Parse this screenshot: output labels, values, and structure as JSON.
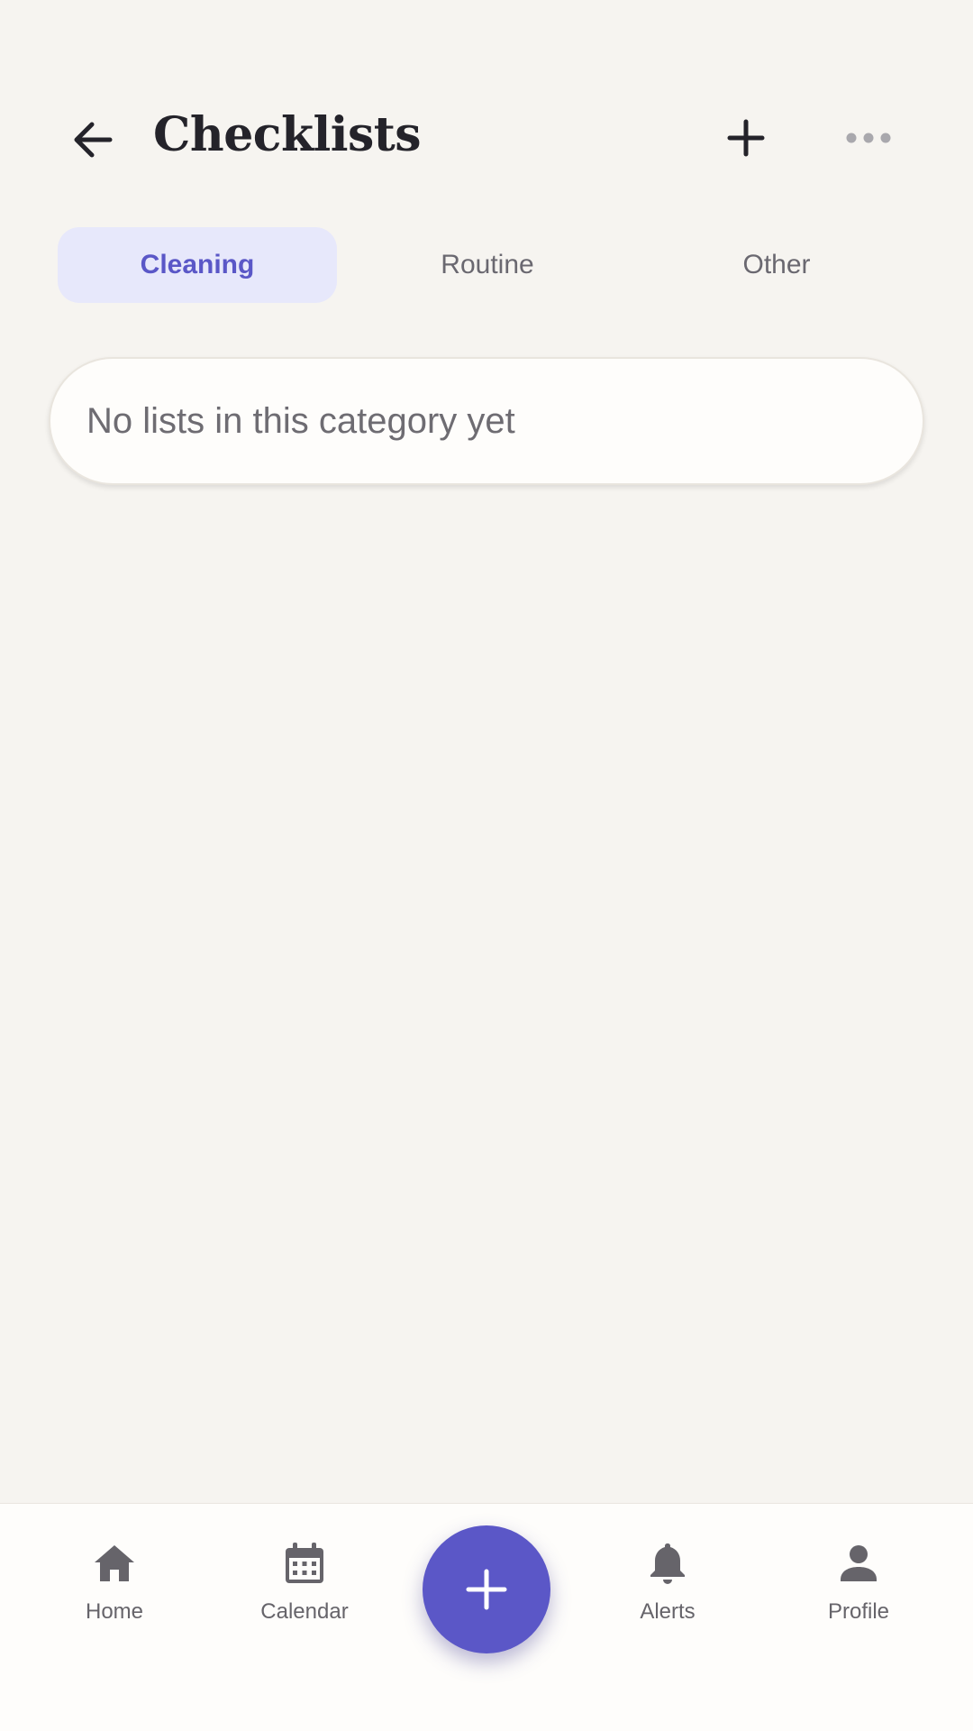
{
  "header": {
    "title": "Checklists",
    "back_icon": "arrow-left-icon",
    "add_icon": "plus-icon",
    "more_icon": "more-horizontal-icon"
  },
  "tabs": [
    {
      "label": "Cleaning",
      "active": true
    },
    {
      "label": "Routine",
      "active": false
    },
    {
      "label": "Other",
      "active": false
    }
  ],
  "empty_state": {
    "message": "No lists in this category yet"
  },
  "bottom_nav": {
    "items": [
      {
        "label": "Home",
        "icon": "home-icon"
      },
      {
        "label": "Calendar",
        "icon": "calendar-icon"
      },
      {
        "label": "Alerts",
        "icon": "bell-icon"
      },
      {
        "label": "Profile",
        "icon": "person-icon"
      }
    ],
    "fab_icon": "plus-icon"
  },
  "colors": {
    "background": "#F6F4F0",
    "accent": "#5B57C7",
    "active_tab_bg": "#E7E8FB",
    "title_text": "#24232A",
    "muted_text": "#6A6870"
  }
}
